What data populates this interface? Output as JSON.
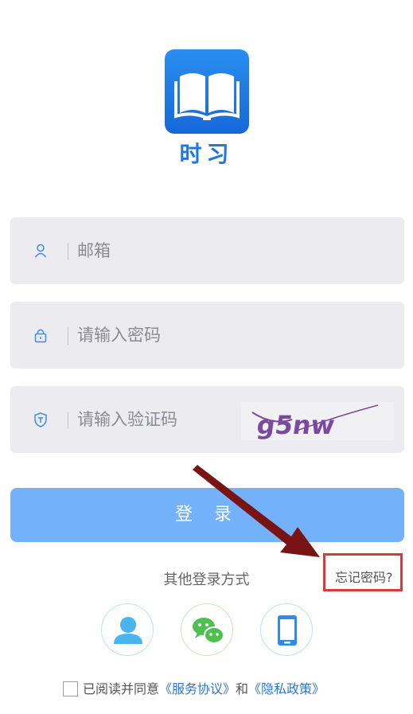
{
  "app": {
    "name": "时习"
  },
  "form": {
    "email_placeholder": "邮箱",
    "password_placeholder": "请输入密码",
    "captcha_placeholder": "请输入验证码",
    "captcha_text": "g5nw"
  },
  "login_label": "登 录",
  "forgot_label": "忘记密码?",
  "other_login_label": "其他登录方式",
  "social": {
    "items": [
      {
        "icon": "user-icon"
      },
      {
        "icon": "wechat-icon"
      },
      {
        "icon": "phone-icon"
      }
    ]
  },
  "agreement": {
    "prefix": "已阅读并同意",
    "service": "《服务协议》",
    "and": "和",
    "privacy": "《隐私政策》"
  },
  "colors": {
    "brand_blue": "#1f78e0",
    "button_blue": "#74b1fb",
    "annotation_red": "#d63a3a",
    "arrow_dark_red": "#7a1414",
    "wechat_green": "#4ec04d"
  }
}
